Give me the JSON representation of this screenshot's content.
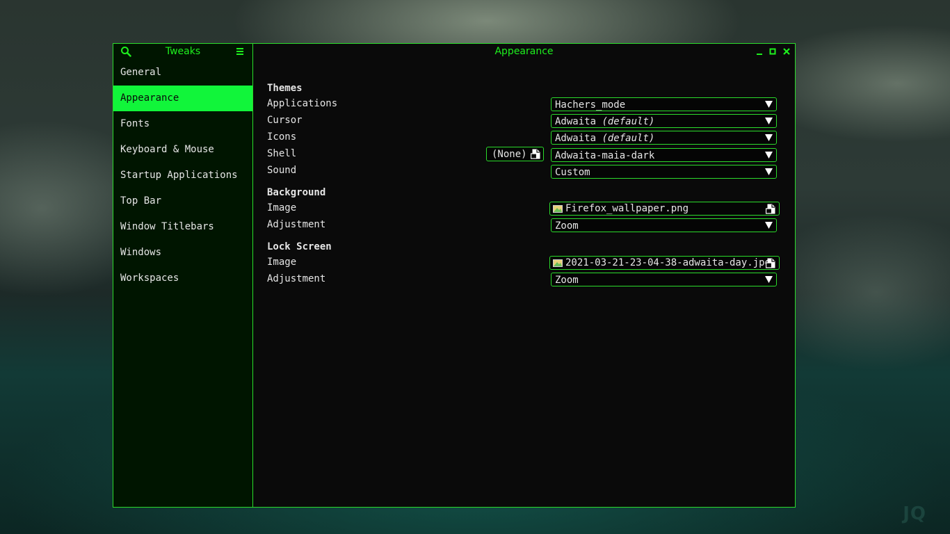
{
  "sidebar": {
    "title": "Tweaks",
    "items": [
      {
        "label": "General"
      },
      {
        "label": "Appearance"
      },
      {
        "label": "Fonts"
      },
      {
        "label": "Keyboard & Mouse"
      },
      {
        "label": "Startup Applications"
      },
      {
        "label": "Top Bar"
      },
      {
        "label": "Window Titlebars"
      },
      {
        "label": "Windows"
      },
      {
        "label": "Workspaces"
      }
    ],
    "active": "Appearance"
  },
  "header": {
    "title": "Appearance"
  },
  "themes": {
    "heading": "Themes",
    "applications": {
      "label": "Applications",
      "value": "Hachers_mode"
    },
    "cursor": {
      "label": "Cursor",
      "value": "Adwaita",
      "suffix": "(default)"
    },
    "icons": {
      "label": "Icons",
      "value": "Adwaita",
      "suffix": "(default)"
    },
    "shell": {
      "label": "Shell",
      "file_value": "(None)",
      "value": "Adwaita-maia-dark"
    },
    "sound": {
      "label": "Sound",
      "value": "Custom"
    }
  },
  "background": {
    "heading": "Background",
    "image": {
      "label": "Image",
      "value": "Firefox_wallpaper.png"
    },
    "adjustment": {
      "label": "Adjustment",
      "value": "Zoom"
    }
  },
  "lock_screen": {
    "heading": "Lock Screen",
    "image": {
      "label": "Image",
      "value": "2021-03-21-23-04-38-adwaita-day.jpg"
    },
    "adjustment": {
      "label": "Adjustment",
      "value": "Zoom"
    }
  },
  "wallpaper_watermark": "JQ",
  "colors": {
    "accent": "#2bdc2b",
    "active_item_bg": "#11f53a",
    "window_bg": "#0a0a0a",
    "sidebar_bg": "#001500"
  },
  "icons": [
    "search-icon",
    "hamburger-menu-icon",
    "minimize-icon",
    "maximize-icon",
    "close-icon",
    "dropdown-arrow-icon",
    "image-file-icon",
    "document-icon"
  ]
}
